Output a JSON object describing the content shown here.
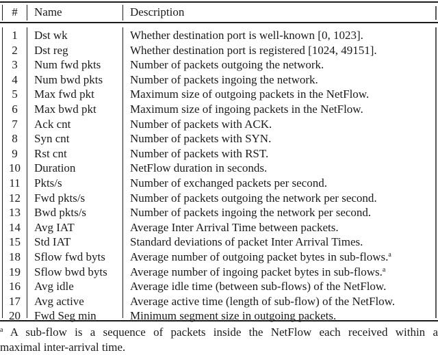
{
  "table": {
    "headers": {
      "num": "#",
      "name": "Name",
      "description": "Description"
    },
    "rows": [
      {
        "num": "1",
        "name": "Dst wk",
        "description": "Whether destination port is well-known [0, 1023].",
        "note": ""
      },
      {
        "num": "2",
        "name": "Dst reg",
        "description": "Whether destination port is registered [1024, 49151].",
        "note": ""
      },
      {
        "num": "3",
        "name": "Num fwd pkts",
        "description": "Number of packets outgoing the network.",
        "note": ""
      },
      {
        "num": "4",
        "name": "Num bwd pkts",
        "description": "Number of packets ingoing the network.",
        "note": ""
      },
      {
        "num": "5",
        "name": "Max fwd pkt",
        "description": "Maximum size of outgoing packets in the NetFlow.",
        "note": ""
      },
      {
        "num": "6",
        "name": "Max bwd pkt",
        "description": "Maximum size of ingoing packets in the NetFlow.",
        "note": ""
      },
      {
        "num": "7",
        "name": "Ack cnt",
        "description": "Number of packets with ACK.",
        "note": ""
      },
      {
        "num": "8",
        "name": "Syn cnt",
        "description": "Number of packets with SYN.",
        "note": ""
      },
      {
        "num": "9",
        "name": "Rst cnt",
        "description": "Number of packets with RST.",
        "note": ""
      },
      {
        "num": "10",
        "name": "Duration",
        "description": "NetFlow duration in seconds.",
        "note": ""
      },
      {
        "num": "11",
        "name": "Pkts/s",
        "description": "Number of exchanged packets per second.",
        "note": ""
      },
      {
        "num": "12",
        "name": "Fwd pkts/s",
        "description": "Number of packets outgoing the network per second.",
        "note": ""
      },
      {
        "num": "13",
        "name": "Bwd pkts/s",
        "description": "Number of packets ingoing the network per second.",
        "note": ""
      },
      {
        "num": "14",
        "name": "Avg IAT",
        "description": "Average Inter Arrival Time between packets.",
        "note": ""
      },
      {
        "num": "15",
        "name": "Std IAT",
        "description": "Standard deviations of packet Inter Arrival Times.",
        "note": ""
      },
      {
        "num": "18",
        "name": "Sflow fwd byts",
        "description": "Average number of outgoing packet bytes in sub-flows.",
        "note": "a"
      },
      {
        "num": "19",
        "name": "Sflow bwd byts",
        "description": "Average number of ingoing packet bytes in sub-flows.",
        "note": "a"
      },
      {
        "num": "16",
        "name": "Avg idle",
        "description": "Average idle time (between sub-flows) of the NetFlow.",
        "note": ""
      },
      {
        "num": "17",
        "name": "Avg active",
        "description": "Average active time (length of sub-flow) of the NetFlow.",
        "note": ""
      },
      {
        "num": "20",
        "name": "Fwd Seg min",
        "description": "Minimum segment size in outgoing packets.",
        "note": ""
      }
    ]
  },
  "footnote": {
    "mark": "a",
    "line1": "A sub-flow is a sequence of packets inside the NetFlow each received within a",
    "line2": "maximal inter-arrival time."
  }
}
